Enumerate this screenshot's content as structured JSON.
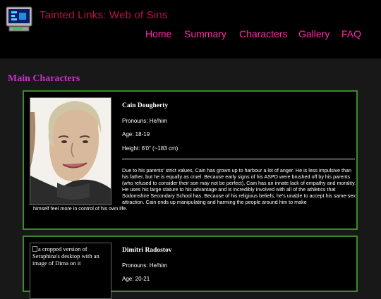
{
  "header": {
    "site_title": "Tainted Links: Web of Sins",
    "logo_icon": "retro-computer-icon",
    "colors": {
      "title": "#c0104a",
      "nav": "#ff2aa8",
      "accent": "#c533c5",
      "card_border": "#3a8a2c"
    }
  },
  "nav": {
    "items": [
      {
        "label": "Home"
      },
      {
        "label": "Summary"
      },
      {
        "label": "Characters"
      },
      {
        "label": "Gallery"
      },
      {
        "label": "FAQ"
      }
    ]
  },
  "main": {
    "section_title": "Main Characters",
    "characters": [
      {
        "name": "Cain Dougherty",
        "pronouns": "Pronouns: He/him",
        "age": "Age: 18-19",
        "height": "Height: 6'0\" (~183 cm)",
        "bio_main": "Due to his parents' strict values, Cain has grown up to harbour a lot of anger. He is less impulsive than his father, but he is equally as cruel. Because early signs of his ASPD were brushed off by his parents (who refused to consider their son may not be perfect), Cain has an innate lack of empathy and morality. He uses his large stature to his advantage and is incredibly involved with all of the athletics that Sodomshire Secondary School has. Because of his religious beliefs, he's unable to accept his same-sex attraction. Cain ends up manipulating and harming the people around him to make",
        "bio_tail": "himself feel more in control of his own life."
      },
      {
        "name": "Dimitri Radostov",
        "pronouns": "Pronouns: He/him",
        "age": "Age: 20-21",
        "image_alt": "a cropped version of Seraphina's desktop with an image of Dima on it"
      }
    ]
  }
}
